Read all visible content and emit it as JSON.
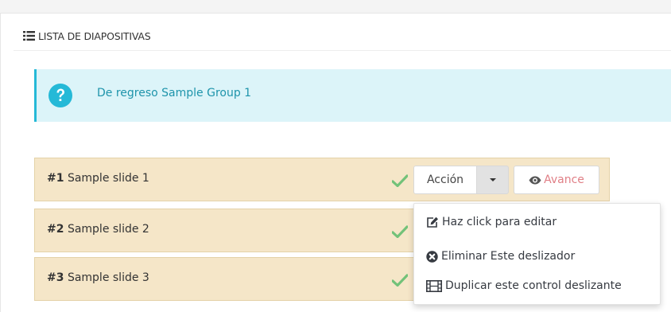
{
  "panel": {
    "heading": "LISTA DE DIAPOSITIVAS"
  },
  "alert": {
    "text": "De regreso Sample Group 1"
  },
  "slides": [
    {
      "number": "#1",
      "title": "Sample slide 1"
    },
    {
      "number": "#2",
      "title": "Sample slide 2"
    },
    {
      "number": "#3",
      "title": "Sample slide 3"
    }
  ],
  "actions": {
    "action_label": "Acción",
    "preview_label": "Avance"
  },
  "dropdown": {
    "items": [
      {
        "label": "Haz click para editar",
        "icon": "edit-icon"
      },
      {
        "label": "Eliminar Este deslizador",
        "icon": "remove-circle-icon"
      },
      {
        "label": "Duplicar este control deslizante",
        "icon": "film-icon"
      }
    ]
  },
  "colors": {
    "alert_bg": "#dcf4f9",
    "alert_accent": "#25b9d7",
    "slide_bg": "#f5e6c8",
    "check_green": "#72c279",
    "preview_text": "#e07f86"
  }
}
